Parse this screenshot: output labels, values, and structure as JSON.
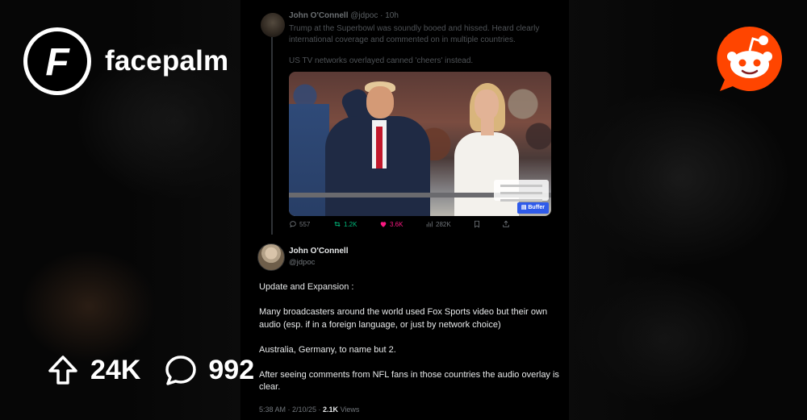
{
  "brand": {
    "subreddit": "facepalm",
    "logo_letter": "F"
  },
  "stats": {
    "upvotes": "24K",
    "comments": "992"
  },
  "tweet": {
    "previous": {
      "author": "John O'Connell",
      "handle_time": "@jdpoc · 10h",
      "paragraphs": [
        "Trump at the Superbowl was soundly booed and hissed. Heard clearly international coverage and commented on in multiple countries.",
        "US TV networks overlayed canned 'cheers' instead."
      ],
      "image_button": "Buffer",
      "actions": {
        "replies": "557",
        "reposts": "1.2K",
        "likes": "3.6K",
        "views": "282K"
      }
    },
    "main": {
      "author": "John O'Connell",
      "handle": "@jdpoc",
      "paragraphs": [
        "Update and Expansion :",
        "Many broadcasters around the world used Fox Sports video but their own audio (esp. if in a foreign language, or just by network choice)",
        "Australia, Germany, to name but 2.",
        "After seeing comments from NFL fans in those countries the audio overlay is clear."
      ],
      "meta_time": "5:38 AM · 2/10/25 · ",
      "meta_views_count": "2.1K",
      "meta_views_label": " Views"
    }
  },
  "colors": {
    "reddit_orange": "#ff4500",
    "like_pink": "#f91880",
    "repost_green": "#00ba7c",
    "buffer_blue": "#2f5bea"
  }
}
